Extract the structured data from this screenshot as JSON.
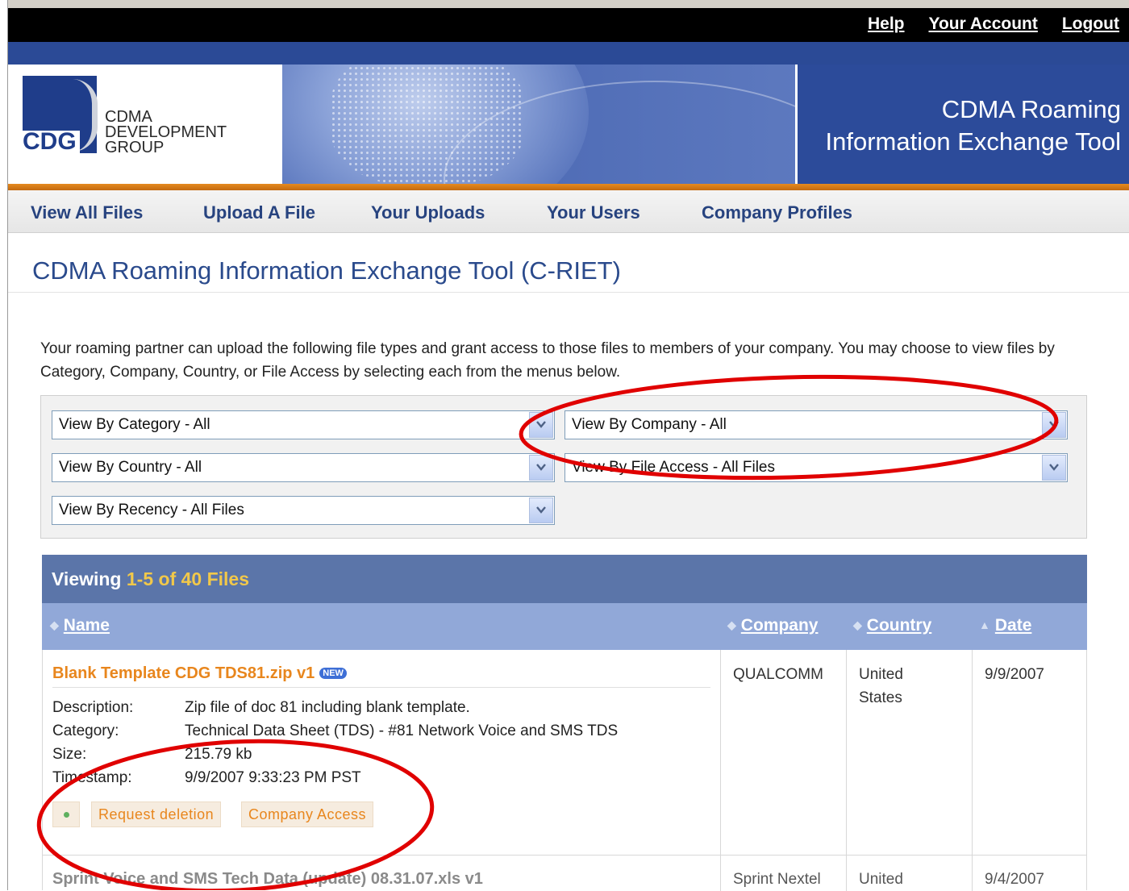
{
  "header": {
    "links": [
      "Help",
      "Your Account",
      "Logout"
    ],
    "logo": {
      "abbr": "CDG",
      "line1": "CDMA",
      "line2": "DEVELOPMENT",
      "line3": "GROUP"
    },
    "banner_title_line1": "CDMA Roaming",
    "banner_title_line2": "Information Exchange Tool"
  },
  "nav": {
    "items": [
      "View All Files",
      "Upload A File",
      "Your Uploads",
      "Your Users",
      "Company Profiles"
    ]
  },
  "page": {
    "title": "CDMA Roaming Information Exchange Tool (C-RIET)",
    "intro": "Your roaming partner can upload the following file types and grant access to those files to members of your company. You may choose to view files by Category, Company, Country, or File Access by selecting each from the menus below."
  },
  "filters": {
    "category": "View By Category - All",
    "company": "View By Company - All",
    "country": "View By Country - All",
    "file_access": "View By File Access - All Files",
    "recency": "View By Recency - All Files"
  },
  "table": {
    "viewing_label": "Viewing",
    "viewing_range": "1-5 of 40 Files",
    "columns": [
      "Name",
      "Company",
      "Country",
      "Date"
    ],
    "meta_labels": [
      "Description:",
      "Category:",
      "Size:",
      "Timestamp:"
    ],
    "rows": [
      {
        "name": "Blank Template CDG TDS81.zip v1",
        "badge": "NEW",
        "description": "Zip file of doc 81 including blank template.",
        "category": "Technical Data Sheet (TDS) - #81 Network Voice and SMS TDS",
        "size": "215.79 kb",
        "timestamp": "9/9/2007 9:33:23 PM PST",
        "company": "QUALCOMM",
        "country_line1": "United",
        "country_line2": "States",
        "date": "9/9/2007",
        "actions": [
          "Request deletion",
          "Company Access"
        ]
      },
      {
        "name": "Sprint Voice and SMS Tech Data (update) 08.31.07.xls v1",
        "company": "Sprint Nextel",
        "country_line1": "United",
        "date": "9/4/2007"
      }
    ]
  },
  "colors": {
    "accent_orange": "#e8861d",
    "header_blue": "#5b75a9",
    "column_blue": "#91a8d8",
    "annotation_red": "#e00000"
  }
}
